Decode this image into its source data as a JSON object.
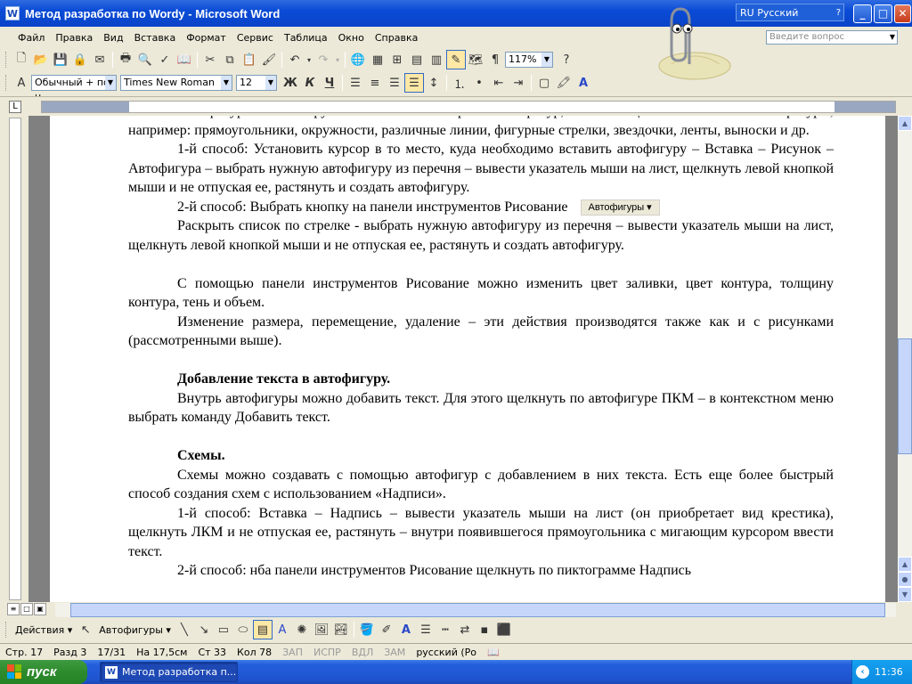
{
  "window": {
    "title": "Метод разработка по Wordy - Microsoft Word",
    "language": "RU Русский",
    "minimize": "_",
    "maximize": "□",
    "close": "✕"
  },
  "menu": [
    "Файл",
    "Правка",
    "Вид",
    "Вставка",
    "Формат",
    "Сервис",
    "Таблица",
    "Окно",
    "Справка"
  ],
  "ask_placeholder": "Введите вопрос",
  "toolbar": {
    "zoom": "117%",
    "style": "Обычный + по ц",
    "font": "Times New Roman",
    "size": "12",
    "bold": "Ж",
    "italic": "К",
    "underline": "Ч"
  },
  "document": {
    "lines": [
      {
        "type": "p",
        "indent": true,
        "html": "Автофигуры – это группа готовых геометрических фигур, включающих в себя основные фигуры, например: прямоугольники, окружности, различные линии, фигурные стрелки, звездочки, ленты, выноски и др."
      },
      {
        "type": "p",
        "indent": true,
        "html": "1-й способ: Установить курсор в то место, куда необходимо вставить автофигуру – Вставка – Рисунок – Автофигура – выбрать нужную автофигуру из перечня – вывести указатель мыши на лист, щелкнуть левой кнопкой мыши и не отпуская ее, растянуть и создать автофигуру."
      },
      {
        "type": "p",
        "indent": true,
        "html": "2-й способ: Выбрать кнопку на панели инструментов Рисование",
        "button": "Автофигуры ▾"
      },
      {
        "type": "p",
        "indent": true,
        "html": "Раскрыть список по стрелке - выбрать нужную автофигуру из перечня – вывести указатель мыши на лист, щелкнуть левой кнопкой мыши и не отпуская ее, растянуть и создать автофигуру."
      },
      {
        "type": "gap"
      },
      {
        "type": "p",
        "indent": true,
        "html": "С помощью панели инструментов Рисование можно изменить цвет заливки, цвет контура, толщину контура, тень и объем."
      },
      {
        "type": "p",
        "indent": true,
        "html": "Изменение размера, перемещение, удаление – эти действия производятся также как и с рисунками (рассмотренными выше)."
      },
      {
        "type": "gap"
      },
      {
        "type": "h",
        "indent": true,
        "html": "Добавление текста в автофигуру."
      },
      {
        "type": "p",
        "indent": true,
        "html": "Внутрь автофигуры можно добавить текст. Для этого щелкнуть по автофигуре ПКМ – в контекстном меню выбрать команду Добавить текст."
      },
      {
        "type": "gap"
      },
      {
        "type": "h",
        "indent": true,
        "html": "Схемы."
      },
      {
        "type": "p",
        "indent": true,
        "html": "Схемы можно создавать с помощью автофигур с добавлением в них текста. Есть еще более быстрый способ создания схем с использованием «Надписи»."
      },
      {
        "type": "p",
        "indent": true,
        "html": "1-й способ: Вставка – Надпись – вывести указатель мыши на лист (он приобретает вид крестика), щелкнуть ЛКМ и не отпуская ее, растянуть – внутри появившегося прямоугольника с мигающим курсором ввести текст."
      },
      {
        "type": "p",
        "indent": true,
        "html": "2-й способ: нба панели инструментов Рисование щелкнуть по пиктограмме Надпись"
      }
    ]
  },
  "drawing_toolbar": {
    "actions": "Действия ▾",
    "autoshapes": "Автофигуры ▾"
  },
  "status": {
    "page": "Стр. 17",
    "section": "Разд 3",
    "pages": "17/31",
    "at": "На 17,5см",
    "line": "Ст 33",
    "col": "Кол 78",
    "rec": "ЗАП",
    "trk": "ИСПР",
    "ext": "ВДЛ",
    "ovr": "ЗАМ",
    "lang": "русский (Ро"
  },
  "taskbar": {
    "start": "пуск",
    "item": "Метод разработка п...",
    "clock": "11:36"
  },
  "colors": {
    "titlebar": "#0a4bd6",
    "taskbar": "#245edb",
    "start": "#2d8a2d",
    "spell": "#e22233",
    "grammar": "#2a8a2a"
  }
}
